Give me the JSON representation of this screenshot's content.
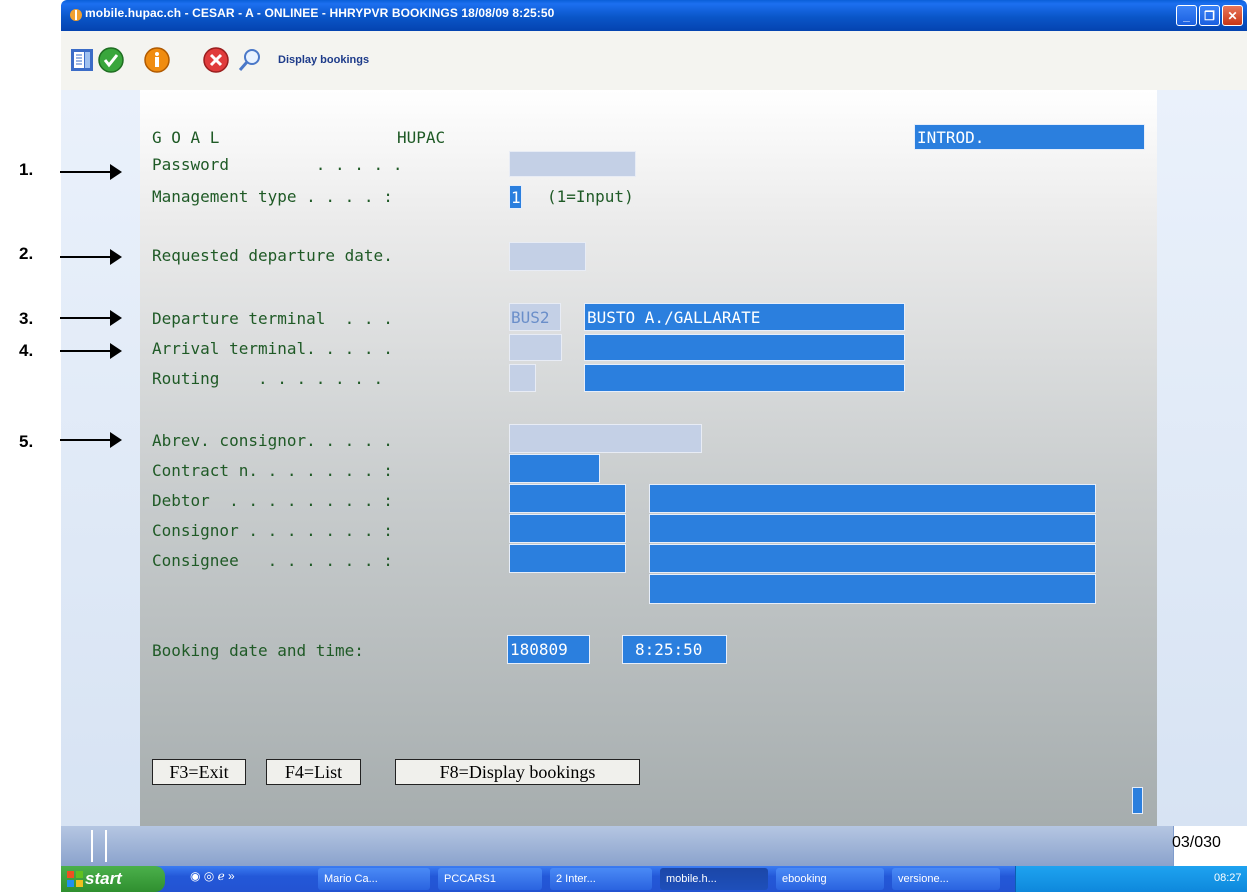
{
  "window": {
    "title": "mobile.hupac.ch - CESAR - A - ONLINEE - HHRYPVR    BOOKINGS 18/08/09  8:25:50",
    "controls": {
      "minimize": "_",
      "maximize": "❐",
      "close": "✕"
    }
  },
  "toolbar": {
    "label": "Display bookings",
    "icons": [
      "document-icon",
      "check-icon",
      "info-icon",
      "cancel-icon",
      "search-icon"
    ]
  },
  "screen": {
    "header": {
      "left": "G O A L",
      "center": "HUPAC",
      "right": "INTROD."
    },
    "fields": {
      "password": {
        "label": "Password         . . . . .",
        "value": ""
      },
      "management_type": {
        "label": "Management type . . . . :",
        "value": "1",
        "hint": "(1=Input)"
      },
      "departure_date": {
        "label": "Requested departure date.",
        "value": ""
      },
      "departure_terminal": {
        "label": "Departure terminal  . . .",
        "code": "BUS2",
        "name": "BUSTO A./GALLARATE"
      },
      "arrival_terminal": {
        "label": "Arrival terminal. . . . .",
        "code": "",
        "name": ""
      },
      "routing": {
        "label": "Routing    . . . . . . .",
        "code": "",
        "name": ""
      },
      "abrev_consignor": {
        "label": "Abrev. consignor. . . . .",
        "value": ""
      },
      "contract": {
        "label": "Contract n. . . . . . . :",
        "value": ""
      },
      "debtor": {
        "label": "Debtor  . . . . . . . . :",
        "code": "",
        "name": ""
      },
      "consignor": {
        "label": "Consignor . . . . . . . :",
        "code": "",
        "name": ""
      },
      "consignee": {
        "label": "Consignee   . . . . . . :",
        "code": "",
        "name": "",
        "name2": ""
      },
      "booking": {
        "label": "Booking date and time:",
        "date": "180809",
        "time": "8:25:50"
      }
    },
    "function_keys": {
      "f3": "F3=Exit",
      "f4": "F4=List",
      "f8": "F8=Display bookings"
    }
  },
  "annotations": [
    "1.",
    "2.",
    "3.",
    "4.",
    "5."
  ],
  "status": {
    "page": "03/030"
  },
  "taskbar": {
    "start": "start",
    "tasks": [
      "Mario Ca...",
      "PCCARS1",
      "2 Inter...",
      "mobile.h...",
      "ebooking",
      "versione..."
    ],
    "clock": "08:27"
  }
}
